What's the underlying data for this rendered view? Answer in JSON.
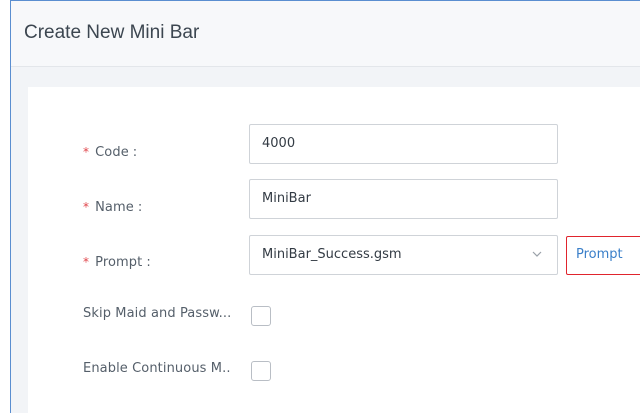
{
  "dialog": {
    "title": "Create New Mini Bar"
  },
  "form": {
    "code": {
      "required_mark": "*",
      "label": "Code",
      "colon": ":",
      "value": "4000"
    },
    "name": {
      "required_mark": "*",
      "label": "Name",
      "colon": ":",
      "value": "MiniBar"
    },
    "prompt": {
      "required_mark": "*",
      "label": "Prompt",
      "colon": ":",
      "value": "MiniBar_Success.gsm",
      "button_label": "Prompt"
    },
    "skip_maid": {
      "label": "Skip Maid and Passw...",
      "checked": false
    },
    "enable_continuous": {
      "label": "Enable Continuous M..",
      "checked": false
    }
  },
  "colors": {
    "frame_border": "#5a8ed0",
    "required": "#e0454b",
    "prompt_button_border": "#e0242d",
    "prompt_button_text": "#3a7fc9"
  }
}
